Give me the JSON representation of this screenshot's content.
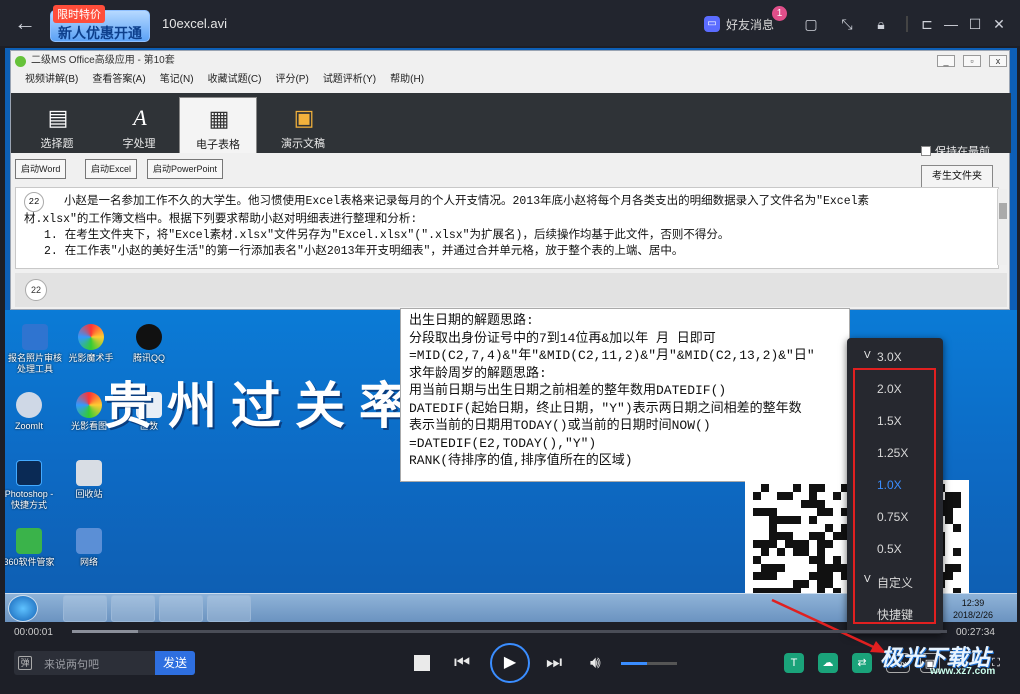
{
  "topbar": {
    "promo_tag": "限时特价",
    "promo_main": "新人优惠开通",
    "file_title": "10excel.avi",
    "friend_label": "好友消息",
    "friend_badge": "1"
  },
  "app_window": {
    "title": "二级MS Office高级应用 - 第10套",
    "menu": [
      "视频讲解(B)",
      "查看答案(A)",
      "笔记(N)",
      "收藏试题(C)",
      "评分(P)",
      "试题评析(Y)",
      "帮助(H)"
    ],
    "tabs": [
      "选择题",
      "字处理",
      "电子表格",
      "演示文稿"
    ],
    "active_tab": "电子表格",
    "keep_on_top": "保持在最前",
    "exam_folder_button": "考生文件夹",
    "launch_buttons": [
      "启动Word",
      "启动Excel",
      "启动PowerPoint"
    ],
    "question_number": "22",
    "question_lines": [
      "小赵是一名参加工作不久的大学生。他习惯使用Excel表格来记录每月的个人开支情况。2013年底小赵将每个月各类支出的明细数据录入了文件名为\"Excel素",
      "材.xlsx\"的工作簿文档中。根据下列要求帮助小赵对明细表进行整理和分析:",
      "1. 在考生文件夹下，将\"Excel素材.xlsx\"文件另存为\"Excel.xlsx\"(\".xlsx\"为扩展名)，后续操作均基于此文件，否则不得分。",
      "2. 在工作表\"小赵的美好生活\"的第一行添加表名\"小赵2013年开支明细表\"，并通过合并单元格，放于整个表的上端、居中。"
    ],
    "bottom_number": "22"
  },
  "desktop_icons": [
    "报名照片审核处理工具",
    "光影魔术手",
    "腾讯QQ",
    "ZoomIt",
    "光影看图",
    "函数",
    "Photoshop - 快捷方式",
    "回收站",
    "360软件管家",
    "网络"
  ],
  "banner_text": "贵州过关率第",
  "notes_lines": [
    "出生日期的解题思路:",
    "分段取出身份证号中的7到14位再&加以年 月 日即可",
    "=MID(C2,7,4)&\"年\"&MID(C2,11,2)&\"月\"&MID(C2,13,2)&\"日\"",
    "求年龄周岁的解题思路:",
    "用当前日期与出生日期之前相差的整年数用DATEDIF()",
    "DATEDIF(起始日期，终止日期，\"Y\")表示两日期之间相差的整年数",
    "表示当前的日期用TODAY()或当前的日期时间NOW()",
    "=DATEDIF(E2,TODAY(),\"Y\")",
    "RANK(待排序的值,排序值所在的区域)"
  ],
  "taskbar": {
    "time": "12:39",
    "date": "2018/2/26"
  },
  "speed_menu": {
    "items": [
      "3.0X",
      "2.0X",
      "1.5X",
      "1.25X",
      "1.0X",
      "0.75X",
      "0.5X",
      "自定义",
      "快捷键"
    ],
    "selected": "1.0X"
  },
  "player": {
    "current_time": "00:00:01",
    "total_time": "00:27:34",
    "progress": 0.075,
    "volume": 0.46,
    "chat_placeholder": "来说两句吧",
    "send_label": "发送",
    "speed_button": "1.0x",
    "accent_color": "#3a8dff"
  },
  "watermark": {
    "main": "极光下载站",
    "url": "www.xz7.com"
  }
}
